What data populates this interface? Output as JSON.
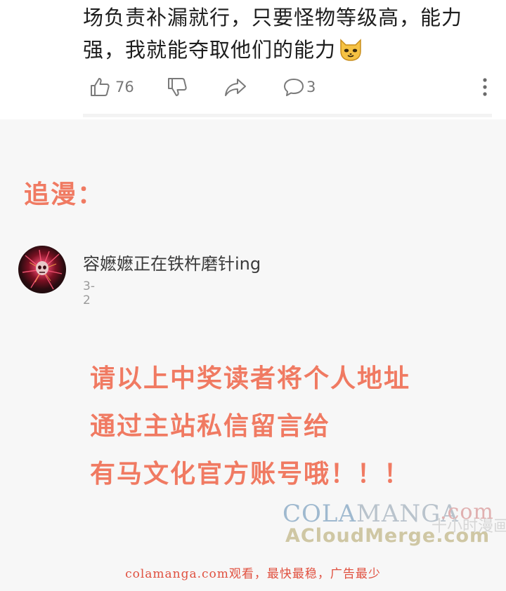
{
  "comment": {
    "line1": "场负责补漏就行，只要怪物等级高，能力",
    "line2": "强，我就能夺取他们的能力",
    "emoji": "cat-face-emoji"
  },
  "actions": {
    "like_count": "76",
    "comment_count": "3",
    "icons": [
      "thumbs-up-icon",
      "thumbs-down-icon",
      "share-icon",
      "comment-icon",
      "more-icon"
    ]
  },
  "heading": "追漫：",
  "user": {
    "name": "容嬷嬷正在铁杵磨针ing",
    "date": "3-2"
  },
  "notice": {
    "line1": "请以上中奖读者将个人地址",
    "line2": "通过主站私信留言给",
    "line3": "有马文化官方账号哦！！！"
  },
  "watermark": {
    "cola": "COLA",
    "manga": "MANGA",
    "dotcom": ".com",
    "line2": "ACloudMerge.com",
    "faint": "十小时漫画"
  },
  "footer": "colamanga.com观看，最快最稳，广告最少",
  "colors": {
    "accent": "#f07a62",
    "footer_red": "#e0503f",
    "text": "#1d1d1d",
    "muted": "#777777"
  }
}
